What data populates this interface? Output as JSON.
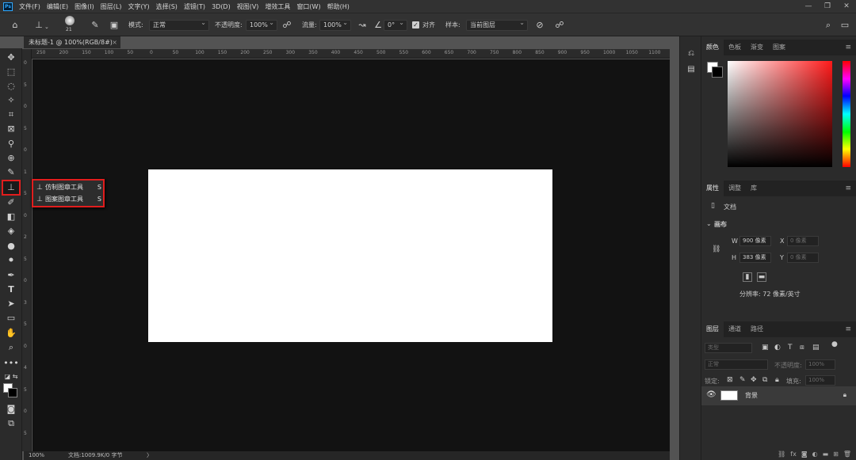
{
  "app": {
    "logo": "Ps"
  },
  "menu": [
    "文件(F)",
    "编辑(E)",
    "图像(I)",
    "图层(L)",
    "文字(Y)",
    "选择(S)",
    "滤镜(T)",
    "3D(D)",
    "视图(V)",
    "增效工具",
    "窗口(W)",
    "帮助(H)"
  ],
  "window": {
    "minimize": "—",
    "restore": "❐",
    "close": "✕"
  },
  "options": {
    "brush_size": "21",
    "mode_label": "模式:",
    "mode_value": "正常",
    "opacity_label": "不透明度:",
    "opacity_value": "100%",
    "flow_label": "流量:",
    "flow_value": "100%",
    "angle_value": "0°",
    "align_label": "对齐",
    "sample_label": "样本:",
    "sample_value": "当前图层"
  },
  "document": {
    "tab_title": "未标题-1 @ 100%(RGB/8#)",
    "close": "×",
    "zoom": "100%",
    "doc_info": "文档:1009.9K/0 字节",
    "status_arrow": "〉"
  },
  "ruler_h": [
    "250",
    "200",
    "150",
    "100",
    "50",
    "0",
    "50",
    "100",
    "150",
    "200",
    "250",
    "300",
    "350",
    "400",
    "450",
    "500",
    "550",
    "600",
    "650",
    "700",
    "750",
    "800",
    "850",
    "900",
    "950",
    "1000",
    "1050",
    "1100"
  ],
  "ruler_v": [
    "0",
    "5",
    "0",
    "5",
    "0",
    "1",
    "5",
    "0",
    "2",
    "5",
    "0",
    "3",
    "5",
    "0",
    "4",
    "5",
    "0",
    "5"
  ],
  "flyout": {
    "items": [
      {
        "label": "仿制图章工具",
        "key": "S"
      },
      {
        "label": "图案图章工具",
        "key": "S"
      }
    ]
  },
  "color_panel": {
    "tabs": [
      "颜色",
      "色板",
      "渐变",
      "图案"
    ],
    "menu": "≡"
  },
  "properties_panel": {
    "tabs": [
      "属性",
      "调整",
      "库"
    ],
    "doc_label": "文档",
    "canvas_label": "画布",
    "w_label": "W",
    "w_value": "900 像素",
    "h_label": "H",
    "h_value": "383 像素",
    "x_label": "X",
    "x_placeholder": "0 像素",
    "y_label": "Y",
    "y_placeholder": "0 像素",
    "resolution": "分辨率: 72 像素/英寸"
  },
  "layers_panel": {
    "tabs": [
      "图层",
      "通道",
      "路径"
    ],
    "filter_placeholder": "类型",
    "blend_mode": "正常",
    "opacity_label": "不透明度:",
    "opacity_value": "100%",
    "lock_label": "锁定:",
    "fill_label": "填充:",
    "fill_value": "100%",
    "layer_name": "背景"
  }
}
